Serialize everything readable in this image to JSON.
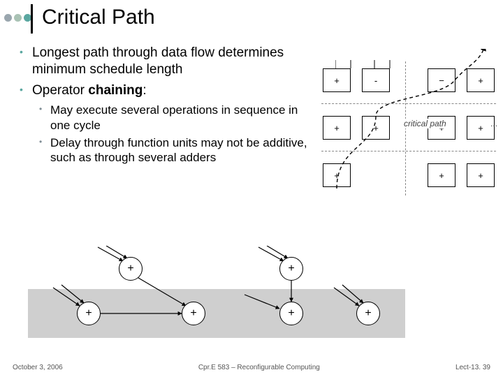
{
  "title": "Critical Path",
  "bullets": {
    "b1": "Longest path through data flow determines minimum schedule length",
    "b2_prefix": "Operator ",
    "b2_bold": "chaining",
    "b2_suffix": ":",
    "b2a": "May execute several operations in sequence in one cycle",
    "b2b": "Delay through function units may not be additive, such as through several adders"
  },
  "rightDiagram": {
    "boxes": {
      "r1a": "+",
      "r1b": "-",
      "r1c": "−",
      "r1d": "+",
      "r2a": "+",
      "r2b": "+",
      "r2c": "+",
      "r2d": "+",
      "r3a": "+",
      "r3b": "",
      "r3c": "+",
      "r3d": "+"
    },
    "label": "critical path",
    "ellipsis": "..."
  },
  "bottomDiagram": {
    "ops": {
      "n1": "+",
      "n2": "+",
      "n3": "+",
      "n4": "+",
      "n5": "+",
      "n6": "+"
    }
  },
  "footer": {
    "left": "October 3, 2006",
    "center": "Cpr.E 583 – Reconfigurable Computing",
    "right": "Lect-13. 39"
  }
}
